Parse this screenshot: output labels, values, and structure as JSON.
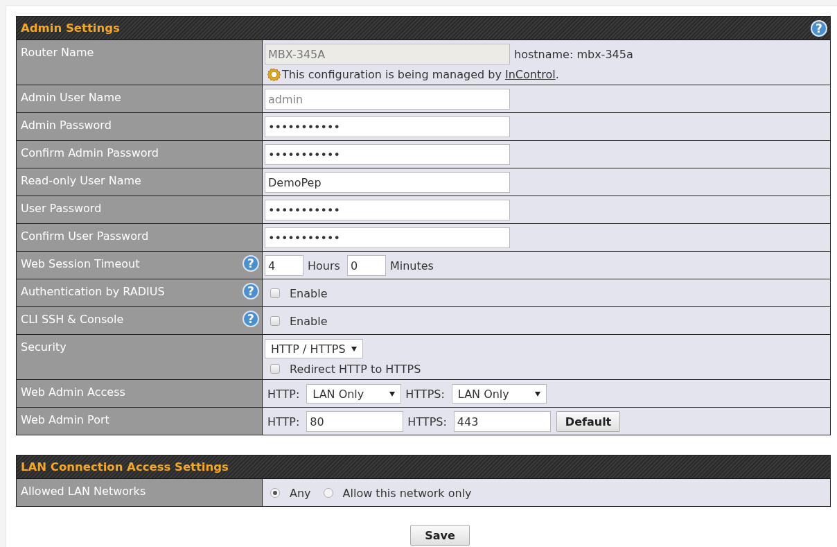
{
  "sections": [
    {
      "title": "Admin Settings",
      "help": "?",
      "rows": [
        {
          "label": "Router Name",
          "lines": [
            [
              {
                "kind": "text_field",
                "value": "MBX-345A",
                "disabled": true,
                "readonly": false
              },
              {
                "kind": "text",
                "text": "hostname: mbx-345a"
              }
            ],
            [
              {
                "kind": "note",
                "text": "This configuration is being managed by ",
                "link": "InControl",
                "after": "."
              }
            ]
          ]
        },
        {
          "label": "Admin User Name",
          "lines": [
            [
              {
                "kind": "text_field",
                "value": "admin",
                "disabled": false,
                "readonly": true
              }
            ]
          ]
        },
        {
          "label": "Admin Password",
          "lines": [
            [
              {
                "kind": "text_field",
                "value": "•••••••••••",
                "disabled": false,
                "readonly": false
              }
            ]
          ]
        },
        {
          "label": "Confirm Admin Password",
          "lines": [
            [
              {
                "kind": "text_field",
                "value": "•••••••••••",
                "disabled": false,
                "readonly": false
              }
            ]
          ]
        },
        {
          "label": "Read-only User Name",
          "lines": [
            [
              {
                "kind": "text_field",
                "value": "DemoPep",
                "disabled": false,
                "readonly": false
              }
            ]
          ]
        },
        {
          "label": "User Password",
          "lines": [
            [
              {
                "kind": "text_field",
                "value": "•••••••••••",
                "disabled": false,
                "readonly": false
              }
            ]
          ]
        },
        {
          "label": "Confirm User Password",
          "lines": [
            [
              {
                "kind": "text_field",
                "value": "•••••••••••",
                "disabled": false,
                "readonly": false
              }
            ]
          ]
        },
        {
          "label": "Web Session Timeout",
          "help": "?",
          "lines": [
            [
              {
                "kind": "number_field",
                "value": "4",
                "disabled": false,
                "readonly": false
              },
              {
                "kind": "text",
                "text": "Hours"
              },
              {
                "kind": "number_field",
                "value": "0",
                "disabled": false,
                "readonly": false
              },
              {
                "kind": "text",
                "text": "Minutes"
              }
            ]
          ]
        },
        {
          "label": "Authentication by RADIUS",
          "help": "?",
          "lines": [
            [
              {
                "kind": "checkbox",
                "label": "Enable",
                "checked": false
              }
            ]
          ]
        },
        {
          "label": "CLI SSH & Console",
          "help": "?",
          "lines": [
            [
              {
                "kind": "checkbox",
                "label": "Enable",
                "checked": false
              }
            ]
          ]
        },
        {
          "label": "Security",
          "lines": [
            [
              {
                "kind": "select",
                "value": "HTTP / HTTPS"
              }
            ],
            [
              {
                "kind": "checkbox",
                "label": "Redirect HTTP to HTTPS",
                "checked": false
              }
            ]
          ]
        },
        {
          "label": "Web Admin Access",
          "lines": [
            [
              {
                "kind": "text",
                "text": "HTTP:"
              },
              {
                "kind": "select",
                "value": "LAN Only"
              },
              {
                "kind": "text",
                "text": "HTTPS:"
              },
              {
                "kind": "select",
                "value": "LAN Only"
              }
            ]
          ]
        },
        {
          "label": "Web Admin Port",
          "lines": [
            [
              {
                "kind": "text",
                "text": "HTTP:"
              },
              {
                "kind": "port_field",
                "value": "80",
                "disabled": false,
                "readonly": false
              },
              {
                "kind": "text",
                "text": "HTTPS:"
              },
              {
                "kind": "port_field",
                "value": "443",
                "disabled": false,
                "readonly": false
              },
              {
                "kind": "button",
                "label": "Default"
              }
            ]
          ]
        }
      ]
    },
    {
      "title": "LAN Connection Access Settings",
      "rows": [
        {
          "label": "Allowed LAN Networks",
          "lines": [
            [
              {
                "kind": "radio",
                "label": "Any",
                "selected": true
              },
              {
                "kind": "radio",
                "label": "Allow this network only",
                "selected": false
              }
            ]
          ]
        }
      ]
    }
  ],
  "save": "Save"
}
